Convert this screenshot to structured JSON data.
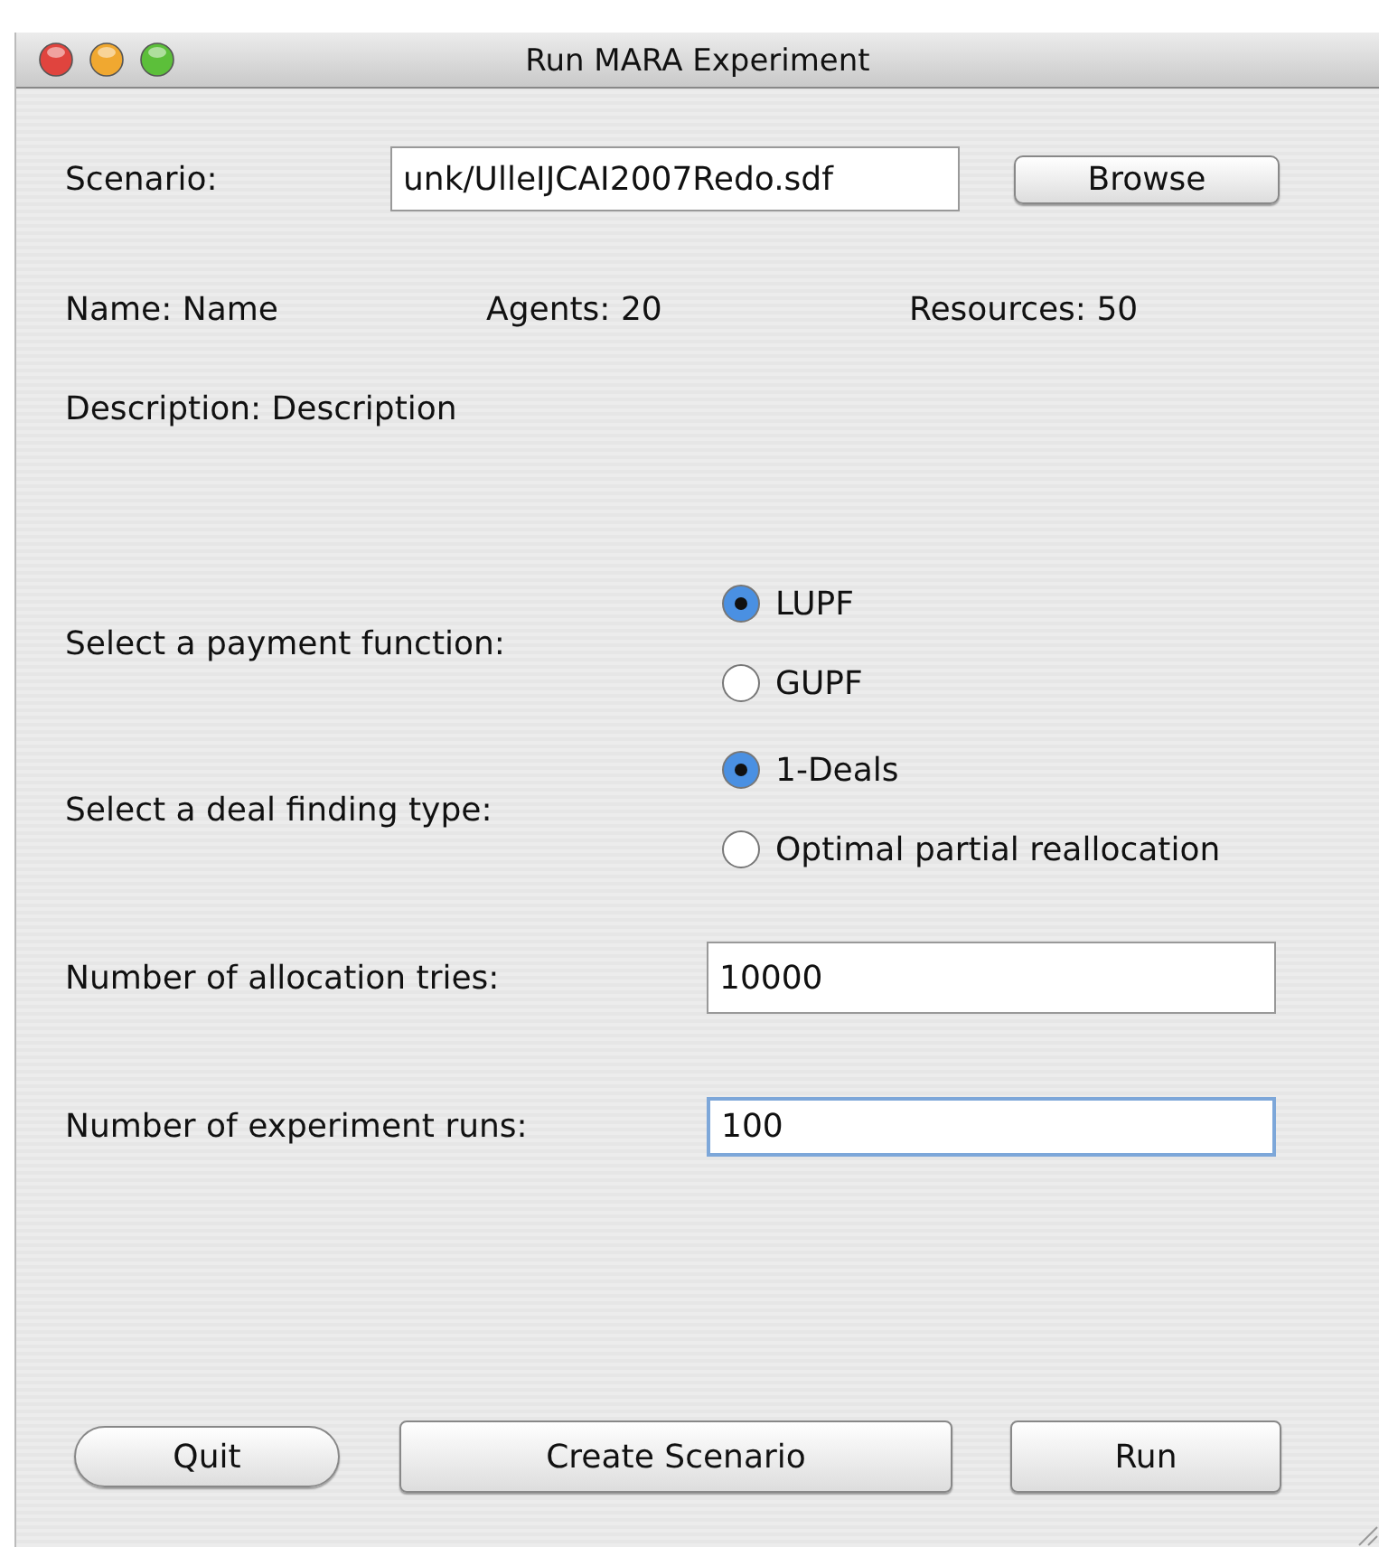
{
  "window": {
    "title": "Run MARA Experiment"
  },
  "scenario": {
    "label": "Scenario:",
    "value": "unk/UlleIJCAI2007Redo.sdf",
    "button": "Browse"
  },
  "info": [
    "Name: Name",
    "Agents: 20",
    "Resources: 50"
  ],
  "description": "Description: Description",
  "radio_groups": [
    {
      "label": "Select a payment function:",
      "options": [
        {
          "label": "LUPF",
          "selected": true
        },
        {
          "label": "GUPF",
          "selected": false
        }
      ]
    },
    {
      "label": "Select a deal finding type:",
      "options": [
        {
          "label": "1-Deals",
          "selected": true
        },
        {
          "label": "Optimal partial reallocation",
          "selected": false
        }
      ]
    }
  ],
  "fields": [
    {
      "label": "Number of allocation tries:",
      "value": "10000",
      "focused": false
    },
    {
      "label": "Number of experiment runs:",
      "value": "100",
      "focused": true
    }
  ],
  "buttons": [
    {
      "label": "Quit",
      "kind": "rounded"
    },
    {
      "label": "Create Scenario",
      "kind": "square"
    },
    {
      "label": "Run",
      "kind": "square"
    }
  ]
}
